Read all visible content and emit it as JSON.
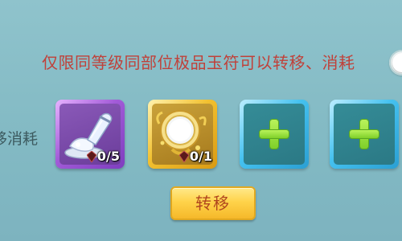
{
  "notice": "仅限同等级同部位极品玉符可以转移、消耗",
  "side_label": "移消耗",
  "slots": [
    {
      "type": "item",
      "item_icon": "milk-bottle-icon",
      "count_icon": "gem-icon",
      "count": "0/5",
      "frame_color": "#a25bd8"
    },
    {
      "type": "item",
      "item_icon": "golden-mirror-icon",
      "count_icon": "gem-icon",
      "count": "0/1",
      "frame_color": "#f2c030"
    },
    {
      "type": "empty",
      "icon": "plus-icon",
      "frame_color": "#45c1ef"
    },
    {
      "type": "empty",
      "icon": "plus-icon",
      "frame_color": "#45c1ef"
    }
  ],
  "transfer_button": {
    "label": "转移"
  },
  "toggle": {
    "state": "off"
  },
  "colors": {
    "background": "#83bac4",
    "notice_text": "#c0413a",
    "button": "#ffd34a",
    "button_text": "#b0461e"
  }
}
